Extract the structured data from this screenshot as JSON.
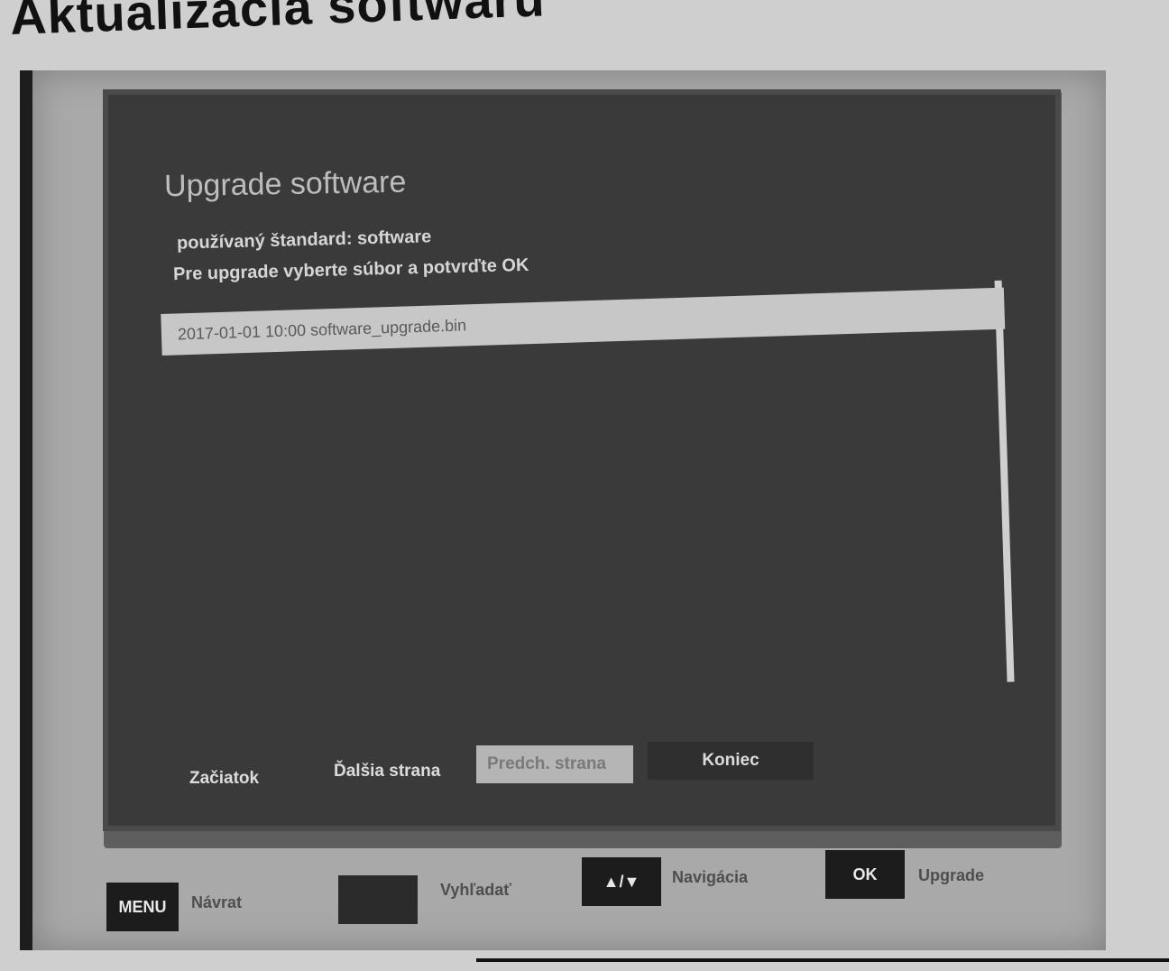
{
  "page": {
    "heading": "Aktualizácia softwaru"
  },
  "dialog": {
    "title": "Upgrade software",
    "line1": "používaný štandard: software",
    "line2": "Pre upgrade vyberte súbor a potvrďte OK",
    "file_row": "2017-01-01 10:00 software_upgrade.bin"
  },
  "buttons": [
    {
      "label": "Začiatok"
    },
    {
      "label": "Ďalšia strana"
    },
    {
      "label": "Predch. strana"
    },
    {
      "label": "Koniec"
    }
  ],
  "keys": [
    {
      "badge": "MENU",
      "label": "Návrat"
    },
    {
      "badge": "",
      "label": "Vyhľadať"
    },
    {
      "badge": "▲/▼",
      "label": "Navigácia"
    },
    {
      "badge": "OK",
      "label": "Upgrade"
    }
  ],
  "colors": {
    "dialog_bg": "#3a3a3a",
    "highlight": "#c7c7c7",
    "key_badge": "#1c1c1c"
  }
}
